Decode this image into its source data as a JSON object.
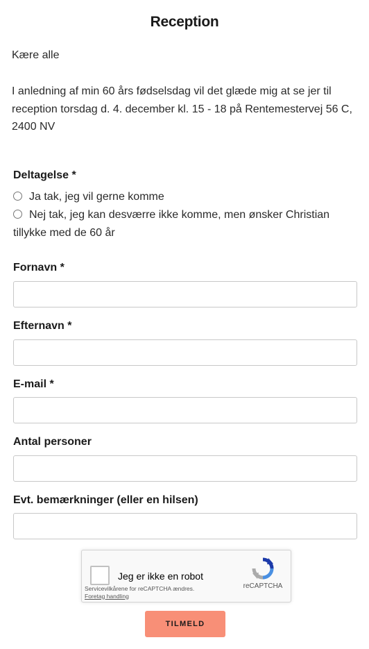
{
  "page": {
    "title": "Reception",
    "greeting": "Kære alle",
    "intro": "I anledning af min 60 års fødselsdag vil det glæde mig at se jer til reception torsdag d. 4. december kl. 15 - 18 på Rentemestervej 56 C, 2400 NV"
  },
  "form": {
    "attendance": {
      "label": "Deltagelse *",
      "options": [
        {
          "label": "Ja tak, jeg vil gerne komme",
          "selected": false
        },
        {
          "label": "Nej tak, jeg kan desværre ikke komme, men ønsker Christian tillykke med de 60 år",
          "selected": false
        }
      ]
    },
    "first_name": {
      "label": "Fornavn *",
      "value": ""
    },
    "last_name": {
      "label": "Efternavn *",
      "value": ""
    },
    "email": {
      "label": "E-mail *",
      "value": ""
    },
    "persons": {
      "label": "Antal personer",
      "value": ""
    },
    "remarks": {
      "label": "Evt. bemærkninger (eller en hilsen)",
      "value": ""
    },
    "submit_label": "TILMELD"
  },
  "captcha": {
    "label": "Jeg er ikke en robot",
    "brand": "reCAPTCHA",
    "terms_text": "Servicevilkårene for reCAPTCHA ændres.",
    "terms_link": "Foretag handling",
    "logo_icon": "recaptcha-logo-icon"
  },
  "colors": {
    "submit_bg": "#f88f77",
    "field_border": "#c8c8c8"
  }
}
